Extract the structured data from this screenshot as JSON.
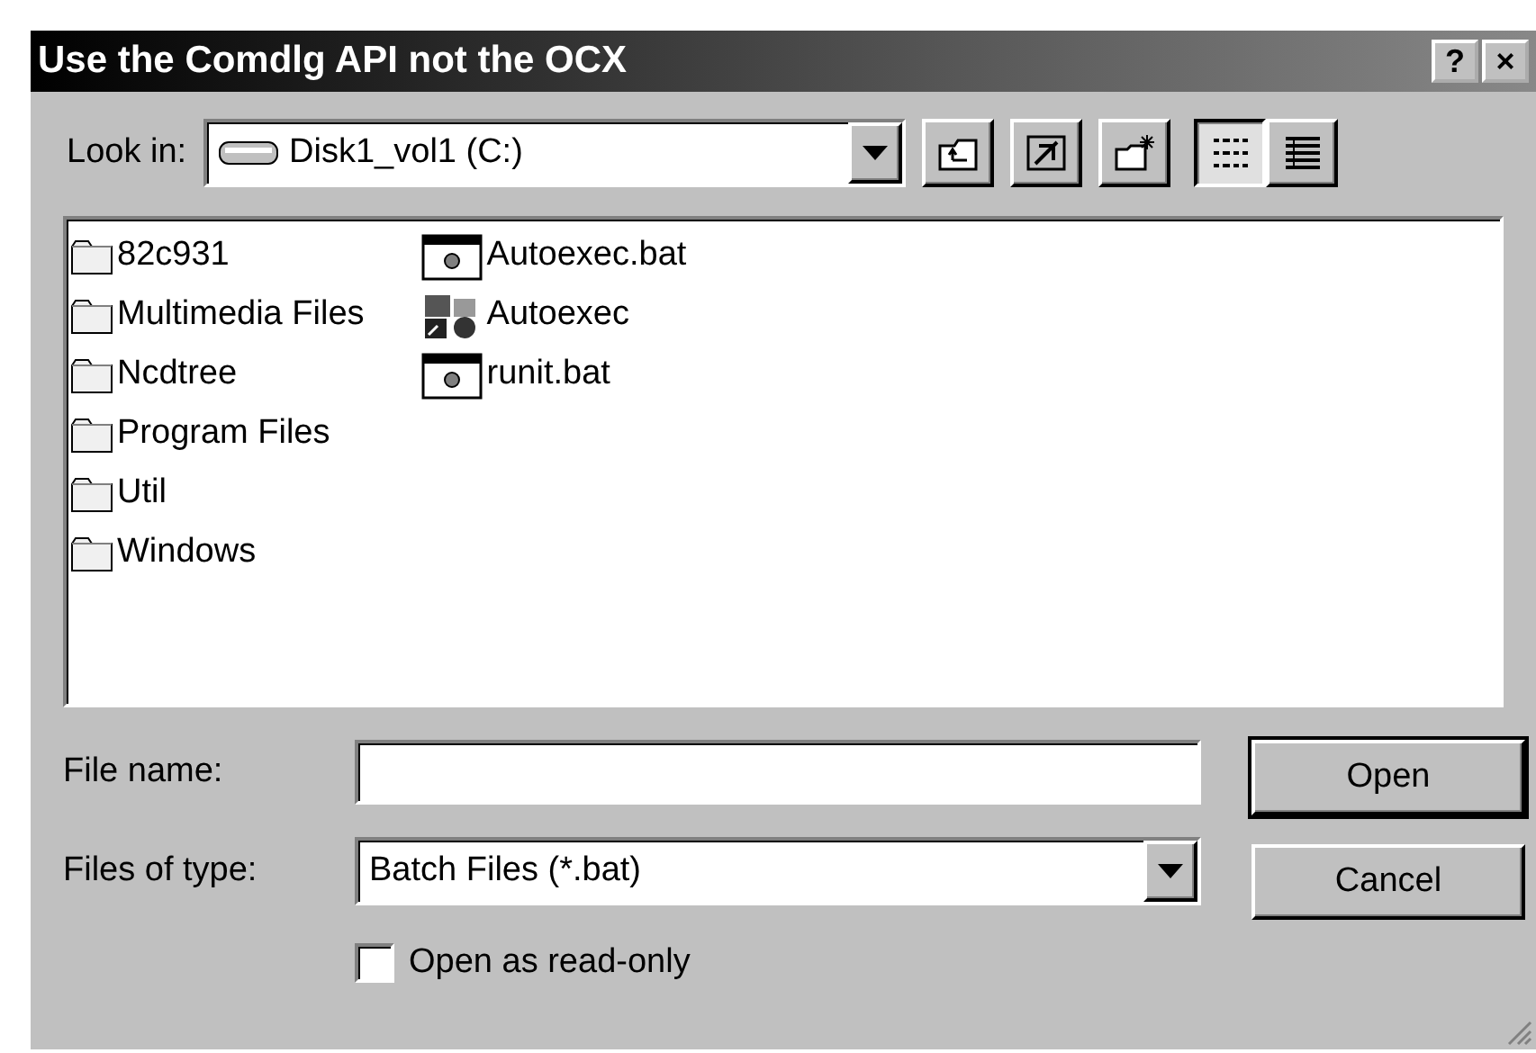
{
  "window": {
    "title": "Use the Comdlg API not the OCX",
    "title_buttons": [
      "?",
      "×"
    ]
  },
  "look_in": {
    "label": "Look in:",
    "value": "Disk1_vol1 (C:)"
  },
  "view_buttons": [
    {
      "kind": "list",
      "selected": true
    },
    {
      "kind": "details",
      "selected": false
    }
  ],
  "files": [
    {
      "kind": "folder",
      "name": "82c931"
    },
    {
      "kind": "folder",
      "name": "Multimedia Files"
    },
    {
      "kind": "folder",
      "name": "Ncdtree"
    },
    {
      "kind": "folder",
      "name": "Program Files"
    },
    {
      "kind": "folder",
      "name": "Util"
    },
    {
      "kind": "folder",
      "name": "Windows"
    },
    {
      "kind": "batch",
      "name": "Autoexec.bat"
    },
    {
      "kind": "msdos",
      "name": "Autoexec"
    },
    {
      "kind": "batch",
      "name": "runit.bat"
    }
  ],
  "file_name": {
    "label": "File name:"
  },
  "file_type": {
    "label": "Files of type:",
    "value": "Batch Files (*.bat)"
  },
  "read_only": {
    "label": "Open as read-only",
    "checked": false
  },
  "buttons": [
    "Open",
    "Cancel"
  ]
}
